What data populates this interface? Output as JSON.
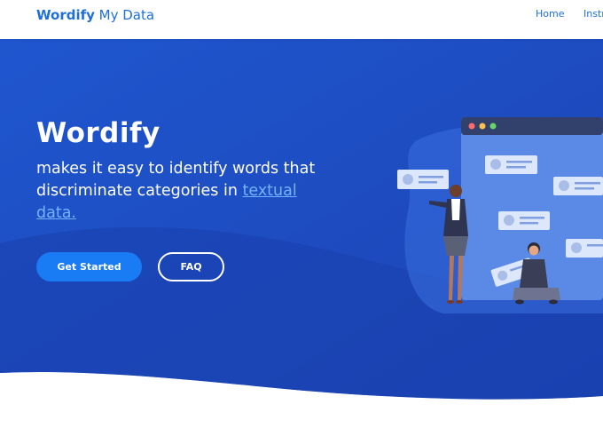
{
  "nav": {
    "brand_bold": "Wordify",
    "brand_rest": " My Data",
    "links": [
      "Home",
      "Instr"
    ]
  },
  "hero": {
    "logo": "Wordify",
    "tagline_text": "makes it easy to identify words that discriminate categories in ",
    "tagline_link": "textual data.",
    "primary_button": "Get Started",
    "secondary_button": "FAQ"
  },
  "colors": {
    "accent": "#1e6fd9",
    "hero_blue": "#1e4fc7",
    "button_blue": "#1a7cf5",
    "link_light": "#74b4ff"
  }
}
